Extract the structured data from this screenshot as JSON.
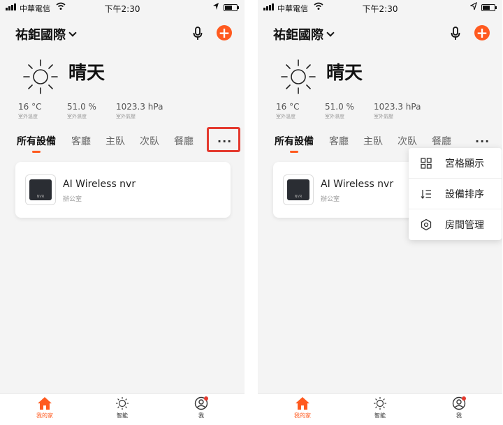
{
  "status_bar": {
    "carrier": "中華電信",
    "time": "下午2:30"
  },
  "header": {
    "home_name": "祐鉅國際"
  },
  "weather": {
    "condition": "晴天",
    "temperature": {
      "value": "16 °C",
      "label": "室外溫度"
    },
    "humidity": {
      "value": "51.0 %",
      "label": "室外濕度"
    },
    "pressure": {
      "value": "1023.3 hPa",
      "label": "室外氣壓"
    }
  },
  "tabs": [
    "所有設備",
    "客廳",
    "主臥",
    "次臥",
    "餐廳"
  ],
  "device": {
    "name": "AI Wireless nvr",
    "room": "辦公室",
    "thumb_label": "NVR"
  },
  "menu": [
    {
      "label": "宮格顯示",
      "icon": "grid-icon"
    },
    {
      "label": "設備排序",
      "icon": "sort-icon"
    },
    {
      "label": "房間管理",
      "icon": "settings-icon"
    }
  ],
  "bottom_nav": [
    {
      "label": "我的家",
      "icon": "home-icon",
      "active": true
    },
    {
      "label": "智能",
      "icon": "sun-icon",
      "active": false
    },
    {
      "label": "我",
      "icon": "profile-icon",
      "active": false
    }
  ],
  "colors": {
    "accent": "#ff5a1f",
    "highlight_border": "#e43a2f",
    "background": "#f4f4f4"
  }
}
